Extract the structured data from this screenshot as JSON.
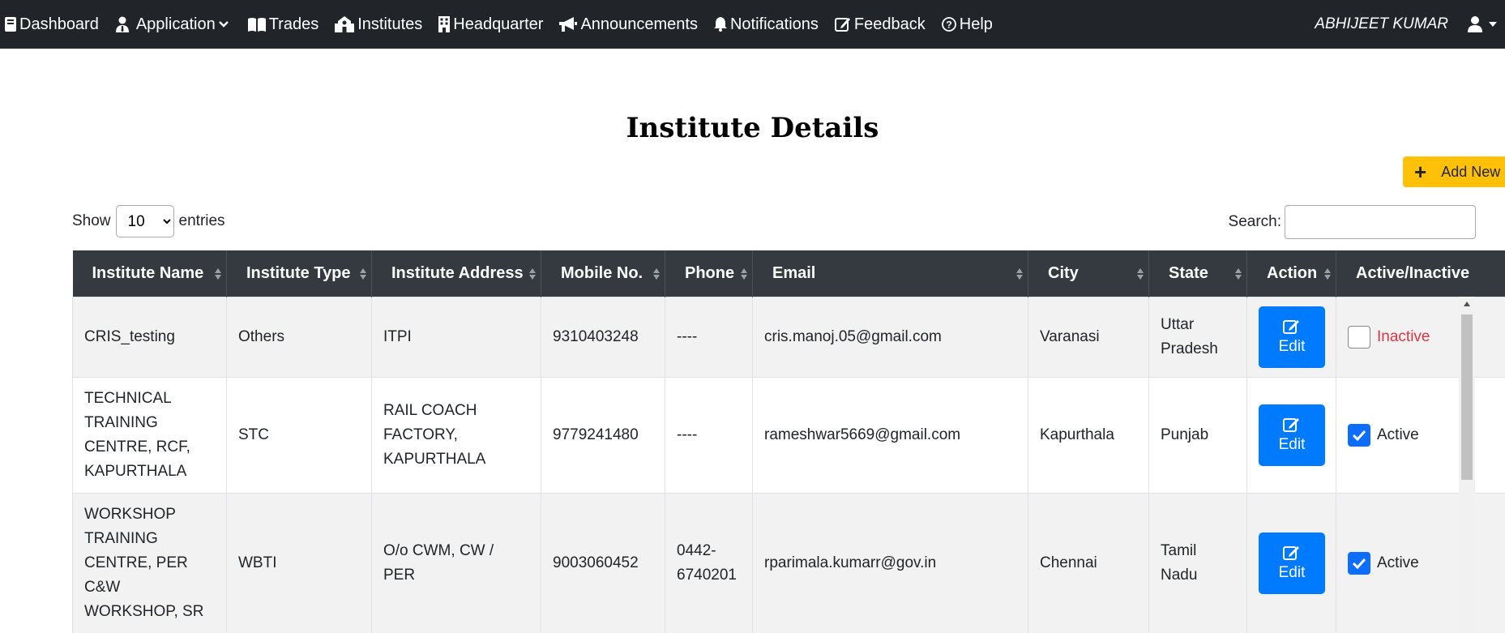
{
  "nav": {
    "items": [
      {
        "label": "Dashboard",
        "icon": "dashboard-icon"
      },
      {
        "label": "Application",
        "icon": "user-tie-icon",
        "dropdown": true
      },
      {
        "label": "Trades",
        "icon": "book-open-icon"
      },
      {
        "label": "Institutes",
        "icon": "school-icon"
      },
      {
        "label": "Headquarter",
        "icon": "building-icon"
      },
      {
        "label": "Announcements",
        "icon": "megaphone-icon"
      },
      {
        "label": "Notifications",
        "icon": "bell-icon"
      },
      {
        "label": "Feedback",
        "icon": "edit-icon"
      },
      {
        "label": "Help",
        "icon": "question-circle-icon"
      }
    ],
    "user_name": "ABHIJEET KUMAR"
  },
  "page": {
    "title": "Institute Details",
    "add_label": "Add New"
  },
  "controls": {
    "show_label": "Show",
    "entries_label": "entries",
    "page_size": "10",
    "search_label": "Search:",
    "search_value": ""
  },
  "table": {
    "columns": [
      "Institute Name",
      "Institute Type",
      "Institute Address",
      "Mobile No.",
      "Phone",
      "Email",
      "City",
      "State",
      "Action",
      "Active/Inactive"
    ],
    "edit_label": "Edit",
    "rows": [
      {
        "name": "CRIS_testing",
        "type": "Others",
        "address": "ITPI",
        "mobile": "9310403248",
        "phone": "----",
        "email": "cris.manoj.05@gmail.com",
        "city": "Varanasi",
        "state": "Uttar Pradesh",
        "active": false,
        "status": "Inactive"
      },
      {
        "name": "TECHNICAL TRAINING CENTRE, RCF, KAPURTHALA",
        "type": "STC",
        "address": "RAIL COACH FACTORY, KAPURTHALA",
        "mobile": "9779241480",
        "phone": "----",
        "email": "rameshwar5669@gmail.com",
        "city": "Kapurthala",
        "state": "Punjab",
        "active": true,
        "status": "Active"
      },
      {
        "name": "WORKSHOP TRAINING CENTRE, PER C&W WORKSHOP, SR",
        "type": "WBTI",
        "address": "O/o CWM, CW / PER",
        "mobile": "9003060452",
        "phone": "0442-6740201",
        "email": "rparimala.kumarr@gov.in",
        "city": "Chennai",
        "state": "Tamil Nadu",
        "active": true,
        "status": "Active"
      }
    ]
  },
  "colors": {
    "navbar": "#212529",
    "table_header": "#343a40",
    "primary": "#007bff",
    "warning": "#ffc107",
    "danger": "#dc3545"
  }
}
